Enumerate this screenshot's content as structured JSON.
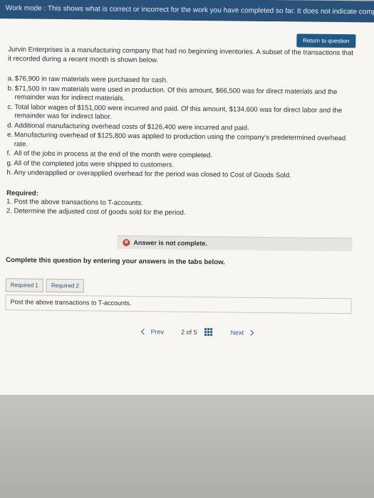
{
  "topbar": {
    "text": "Work mode : This shows what is correct or incorrect for the work you have completed so far. It does not indicate completion."
  },
  "return_button": "Return to question",
  "intro": "Jurvin Enterprises is a manufacturing company that had no beginning inventories. A subset of the transactions that it recorded during a recent month is shown below.",
  "transactions": [
    {
      "letter": "a.",
      "text": "$76,900 in raw materials were purchased for cash."
    },
    {
      "letter": "b.",
      "text": "$71,500 in raw materials were used in production. Of this amount, $66,500 was for direct materials and the remainder was for indirect materials."
    },
    {
      "letter": "c.",
      "text": "Total labor wages of $151,000 were incurred and paid. Of this amount, $134,600 was for direct labor and the remainder was for indirect labor."
    },
    {
      "letter": "d.",
      "text": "Additional manufacturing overhead costs of $126,400 were incurred and paid."
    },
    {
      "letter": "e.",
      "text": "Manufacturing overhead of $125,800 was applied to production using the company's predetermined overhead rate."
    },
    {
      "letter": "f.",
      "text": "All of the jobs in process at the end of the month were completed."
    },
    {
      "letter": "g.",
      "text": "All of the completed jobs were shipped to customers."
    },
    {
      "letter": "h.",
      "text": "Any underapplied or overapplied overhead for the period was closed to Cost of Goods Sold."
    }
  ],
  "required": {
    "title": "Required:",
    "items": [
      "1. Post the above transactions to T-accounts.",
      "2. Determine the adjusted cost of goods sold for the period."
    ]
  },
  "answer_status": "Answer is not complete.",
  "complete_question": "Complete this question by entering your answers in the tabs below.",
  "tabs": [
    "Required 1",
    "Required 2"
  ],
  "post_text": "Post the above transactions to T-accounts.",
  "pager": {
    "prev": "Prev",
    "page": "2",
    "of": "of",
    "total": "5",
    "next": "Next"
  },
  "colors": {
    "topbar": "#29527a",
    "button": "#1f5a86",
    "error": "#d23a3a",
    "link": "#2a5b8a"
  }
}
